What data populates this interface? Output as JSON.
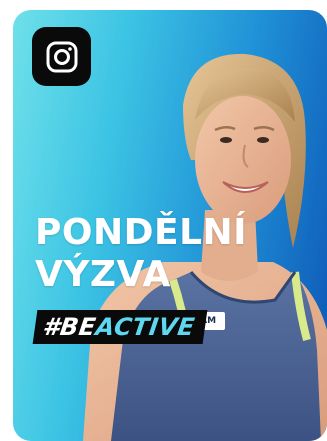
{
  "card": {
    "headline_line1": "PONDĚLNÍ",
    "headline_line2": "VÝZVA",
    "hashtag_prefix": "#BE",
    "hashtag_accent": "ACTIVE",
    "social_icon": "instagram-icon",
    "sponsor_logo_text": "EAM"
  },
  "colors": {
    "gradient_start": "#6fe0ea",
    "gradient_end": "#0d55b4",
    "hashtag_bg": "#0a0a0a",
    "hashtag_accent": "#5ed8f0",
    "badge_bg": "#0a0a0a"
  }
}
